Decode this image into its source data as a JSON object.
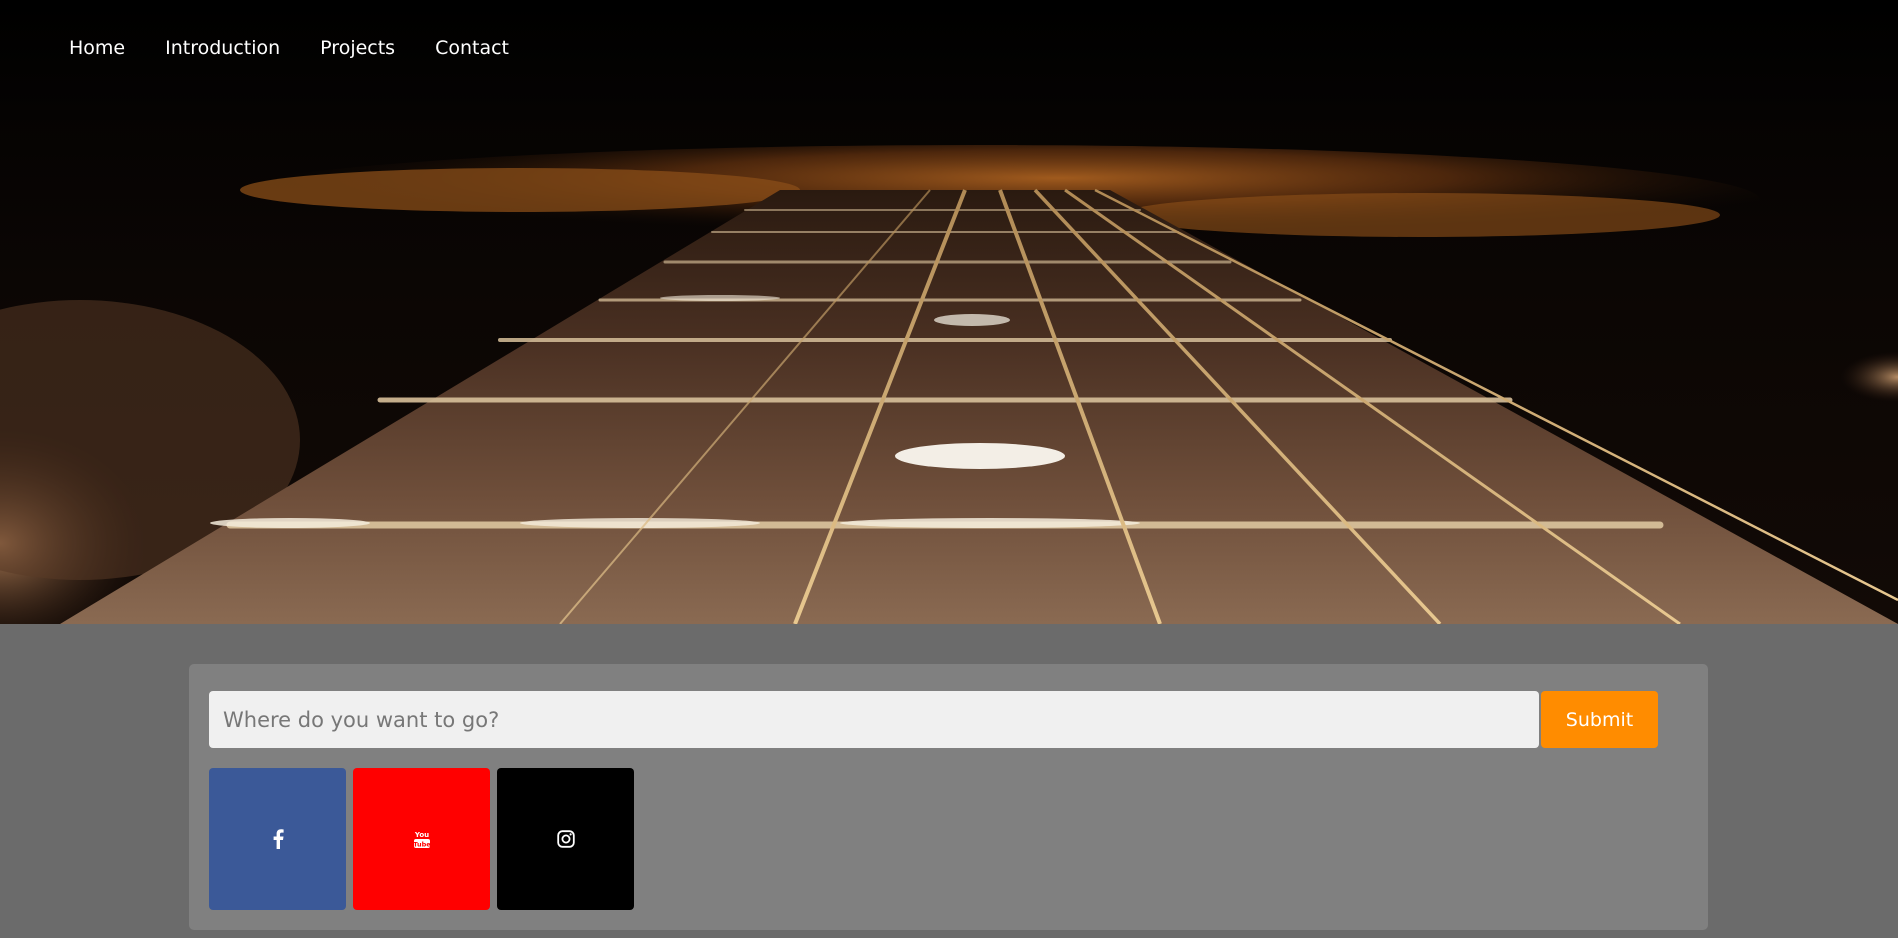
{
  "nav": {
    "items": [
      {
        "label": "Home"
      },
      {
        "label": "Introduction"
      },
      {
        "label": "Projects"
      },
      {
        "label": "Contact"
      }
    ]
  },
  "hero": {
    "image": "guitar-fretboard-photo"
  },
  "search": {
    "placeholder": "Where do you want to go?",
    "value": "",
    "submit_label": "Submit"
  },
  "social": {
    "items": [
      {
        "icon": "facebook-icon",
        "color": "#3b5998"
      },
      {
        "icon": "youtube-icon",
        "color": "#ff0000"
      },
      {
        "icon": "instagram-icon",
        "color": "#000000"
      }
    ]
  },
  "colors": {
    "page_background": "#6b6b6b",
    "panel_background": "#808080",
    "submit_accent": "#ff8c00",
    "nav_text": "#ffffff"
  }
}
